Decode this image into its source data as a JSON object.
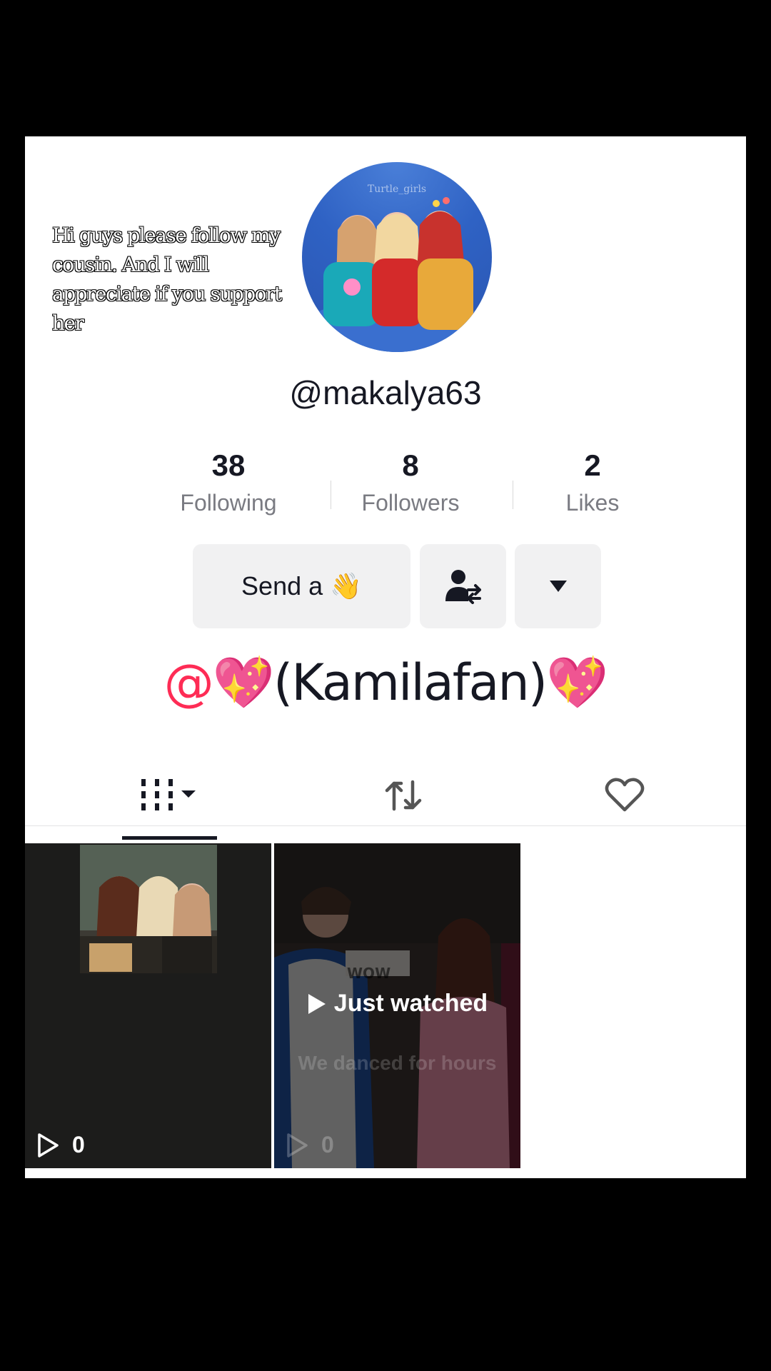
{
  "caption": "Hi guys please follow my cousin. And I will appreciate if you support her",
  "avatar": {
    "watermark": "Turtle_girls"
  },
  "profile": {
    "username": "@makalya63"
  },
  "stats": [
    {
      "value": "38",
      "label": "Following"
    },
    {
      "value": "8",
      "label": "Followers"
    },
    {
      "value": "2",
      "label": "Likes"
    }
  ],
  "actions": {
    "send_label": "Send a 👋"
  },
  "bio": {
    "at": "@",
    "heart": "💖",
    "name": "(Kamilafan)"
  },
  "videos": [
    {
      "views": "0"
    },
    {
      "overlay": "Just watched",
      "caption": "We danced for hours",
      "views": "0",
      "sign": "WOW"
    }
  ],
  "colors": {
    "accent": "#fe2c55",
    "text": "#161823",
    "muted": "#7a7b82"
  }
}
